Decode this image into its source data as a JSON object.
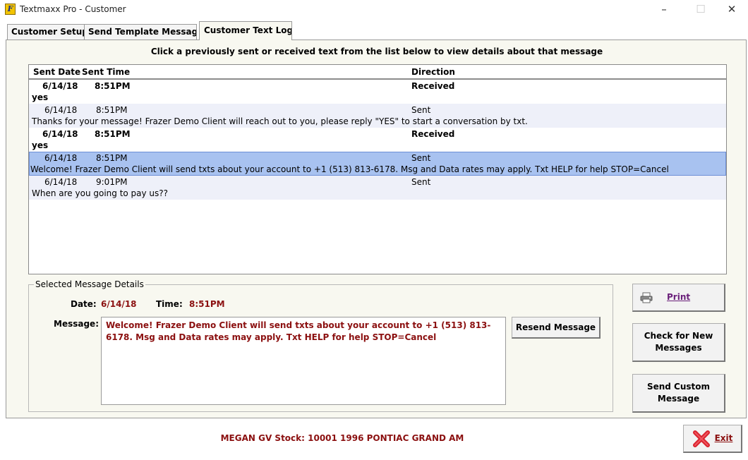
{
  "window": {
    "title": "Textmaxx Pro - Customer",
    "app_icon": "app-logo-icon"
  },
  "tabs": [
    {
      "label": "Customer Setup",
      "active": false
    },
    {
      "label": "Send Template Message",
      "active": false
    },
    {
      "label": "Customer Text Log",
      "active": true
    }
  ],
  "instruction": "Click a previously sent or received text from the list below to view details about that message",
  "list": {
    "columns": [
      "Sent Date",
      "Sent Time",
      "Direction"
    ],
    "messages": [
      {
        "date": "6/14/18",
        "time": "8:51PM",
        "direction": "Received",
        "body": "yes"
      },
      {
        "date": "6/14/18",
        "time": "8:51PM",
        "direction": "Sent",
        "body": "Thanks for your message! Frazer Demo Client will reach out to you, please reply \"YES\" to start a conversation by txt."
      },
      {
        "date": "6/14/18",
        "time": "8:51PM",
        "direction": "Received",
        "body": "yes"
      },
      {
        "date": "6/14/18",
        "time": "8:51PM",
        "direction": "Sent",
        "body": "Welcome! Frazer Demo Client will send txts about your account to +1 (513) 813-6178. Msg and Data rates may apply. Txt HELP for help STOP=Cancel"
      },
      {
        "date": "6/14/18",
        "time": "9:01PM",
        "direction": "Sent",
        "body": "When are you going to pay us??"
      }
    ]
  },
  "details": {
    "title": "Selected Message Details",
    "date_label": "Date:",
    "date_value": "6/14/18",
    "time_label": "Time:",
    "time_value": "8:51PM",
    "message_label": "Message:",
    "message_value": "Welcome! Frazer Demo Client will send txts about your account to +1 (513) 813-6178. Msg and Data rates may apply. Txt HELP for help STOP=Cancel",
    "resend_label": "Resend Message"
  },
  "buttons": {
    "print": "Print",
    "check_line1": "Check for New",
    "check_line2": "Messages",
    "send_line1": "Send Custom",
    "send_line2": "Message",
    "exit": "Exit"
  },
  "footer": {
    "customer_info": "MEGAN GV  Stock: 10001  1996 PONTIAC GRAND AM"
  },
  "colors": {
    "accent_text": "#8b1010",
    "selected_row": "#a8c2f0",
    "alt_row": "#eef0f9",
    "panel_bg": "#f8f8f0",
    "exit_red": "#d9232d",
    "print_purple": "#6a1f7a"
  }
}
